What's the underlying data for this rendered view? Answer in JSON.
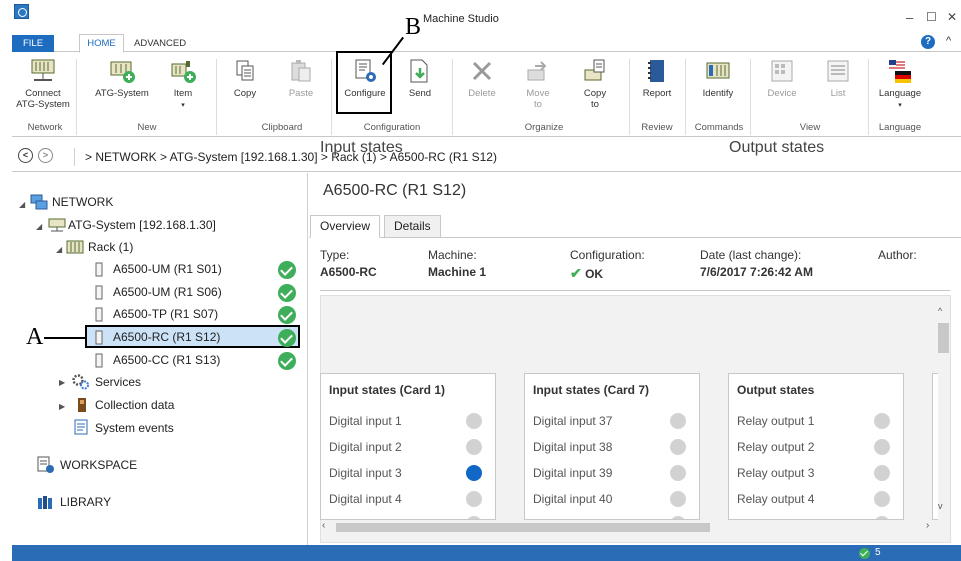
{
  "window": {
    "title": "Machine Studio",
    "minimize": "–",
    "maximize": "☐",
    "close": "✕"
  },
  "ribbon_tabs": {
    "file": "FILE",
    "home": "HOME",
    "advanced": "ADVANCED",
    "help": "?",
    "collapse": "^"
  },
  "ribbon": {
    "connect": "Connect\nATG-System",
    "atg_system": "ATG-System",
    "item": "Item",
    "copy": "Copy",
    "paste": "Paste",
    "configure": "Configure",
    "send": "Send",
    "delete": "Delete",
    "move_to": "Move\nto",
    "copy_to": "Copy\nto",
    "report": "Report",
    "identify": "Identify",
    "device": "Device",
    "list": "List",
    "language": "Language",
    "groups": {
      "network": "Network",
      "new": "New",
      "clipboard": "Clipboard",
      "configuration": "Configuration",
      "organize": "Organize",
      "review": "Review",
      "commands": "Commands",
      "view": "View",
      "language": "Language"
    }
  },
  "callouts": {
    "a": "A",
    "b": "B"
  },
  "address": {
    "path": "> NETWORK > ATG-System [192.168.1.30] > Rack (1) > A6500-RC (R1 S12)"
  },
  "tree": {
    "network": "NETWORK",
    "atg": "ATG-System [192.168.1.30]",
    "rack": "Rack (1)",
    "devices": [
      "A6500-UM (R1 S01)",
      "A6500-UM (R1 S06)",
      "A6500-TP (R1 S07)",
      "A6500-RC (R1 S12)",
      "A6500-CC (R1 S13)"
    ],
    "services": "Services",
    "collection": "Collection data",
    "events": "System events",
    "workspace": "WORKSPACE",
    "library": "LIBRARY"
  },
  "main": {
    "title": "A6500-RC (R1 S12)",
    "tabs": [
      "Overview",
      "Details"
    ],
    "info": {
      "type_label": "Type:",
      "type_value": "A6500-RC",
      "machine_label": "Machine:",
      "machine_value": "Machine 1",
      "config_label": "Configuration:",
      "config_value": "OK",
      "date_label": "Date (last change):",
      "date_value": "7/6/2017 7:26:42 AM",
      "author_label": "Author:"
    },
    "input_states_heading": "Input states",
    "output_states_heading": "Output states",
    "cards": [
      {
        "title": "Input states (Card 1)",
        "rows": [
          "Digital input 1",
          "Digital input 2",
          "Digital input 3",
          "Digital input 4"
        ],
        "active": [
          false,
          false,
          true,
          false
        ]
      },
      {
        "title": "Input states (Card 7)",
        "rows": [
          "Digital input 37",
          "Digital input 38",
          "Digital input 39",
          "Digital input 40"
        ],
        "active": [
          false,
          false,
          false,
          false
        ]
      },
      {
        "title": "Output states",
        "rows": [
          "Relay output 1",
          "Relay output 2",
          "Relay output 3",
          "Relay output 4"
        ],
        "active": [
          false,
          false,
          false,
          false
        ]
      }
    ]
  },
  "status": {
    "count": "5"
  },
  "colors": {
    "accent": "#1e6cc0",
    "status_bar": "#2a6cb5",
    "ok_green": "#3fae5a",
    "led_on": "#1167c6",
    "led_off": "#d2d2d2",
    "selection": "#cce3f7"
  }
}
